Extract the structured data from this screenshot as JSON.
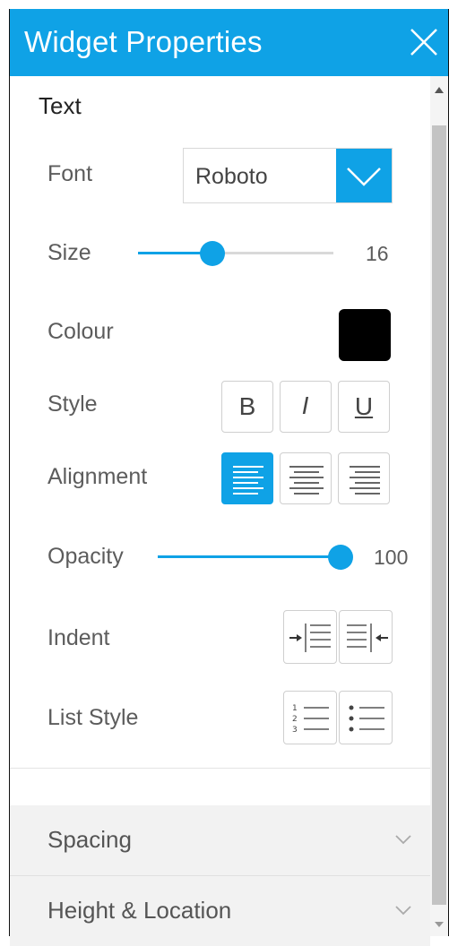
{
  "header": {
    "title": "Widget Properties",
    "close_icon": "close-icon"
  },
  "section": {
    "title": "Text"
  },
  "font": {
    "label": "Font",
    "value": "Roboto"
  },
  "size": {
    "label": "Size",
    "value": "16",
    "level": 0.38
  },
  "colour": {
    "label": "Colour",
    "value": "#000000"
  },
  "style": {
    "label": "Style",
    "bold": "B",
    "italic": "I",
    "underline": "U"
  },
  "alignment": {
    "label": "Alignment",
    "selected": "left"
  },
  "opacity": {
    "label": "Opacity",
    "value": "100",
    "level": 1.0
  },
  "indent": {
    "label": "Indent"
  },
  "list_style": {
    "label": "List Style"
  },
  "accordions": [
    {
      "label": "Spacing"
    },
    {
      "label": "Height & Location"
    }
  ],
  "colors": {
    "accent": "#0fa2e6"
  }
}
